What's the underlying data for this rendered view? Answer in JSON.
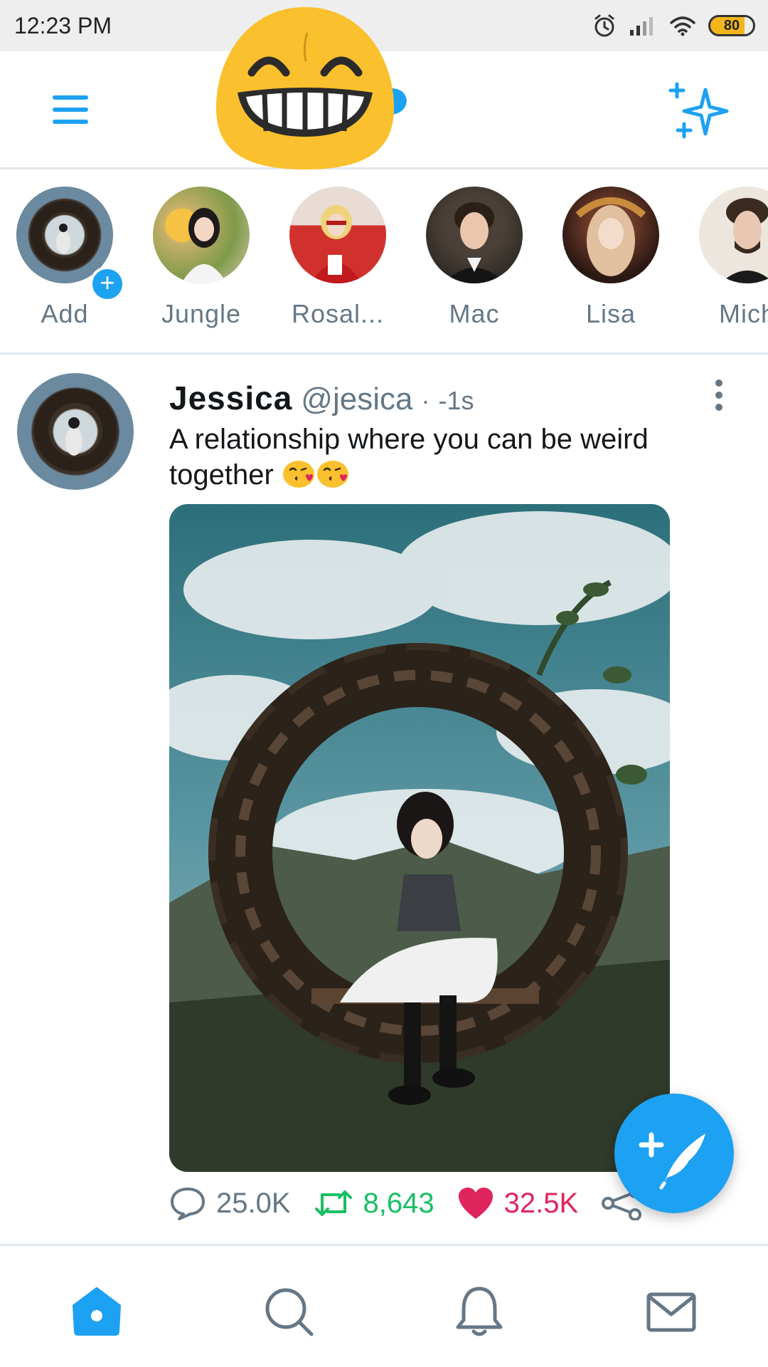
{
  "status_bar": {
    "time": "12:23 PM",
    "battery": "80",
    "icons": [
      "alarm-icon",
      "signal-icon",
      "wifi-icon",
      "battery-icon"
    ]
  },
  "header": {
    "left_icon": "menu-icon",
    "center_logo": "grinning-emoji-logo",
    "right_icon": "sparkle-icon",
    "accent_color": "#1da1f2"
  },
  "stories": [
    {
      "label": "Add",
      "badge": "+"
    },
    {
      "label": "Jungle"
    },
    {
      "label": "Rosal..."
    },
    {
      "label": "Mac"
    },
    {
      "label": "Lisa"
    },
    {
      "label": "Mich"
    }
  ],
  "tweet": {
    "name": "Jessica",
    "handle": "@jesica",
    "separator": "·",
    "time": "-1s",
    "text": "A relationship where you can be weird together",
    "emoji": [
      "kissing-face-heart",
      "kissing-face-heart"
    ],
    "actions": {
      "reply_count": "25.0K",
      "retweet_count": "8,643",
      "like_count": "32.5K"
    }
  },
  "bottom_nav": {
    "items": [
      "home-icon",
      "search-icon",
      "notifications-icon",
      "messages-icon"
    ],
    "active": "home-icon"
  }
}
